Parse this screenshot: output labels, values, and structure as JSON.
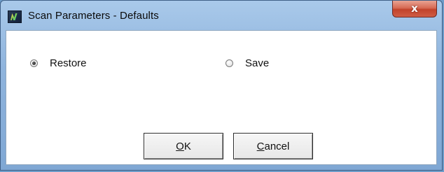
{
  "window": {
    "title": "Scan Parameters - Defaults",
    "close_glyph": "x"
  },
  "options": [
    {
      "label": "Restore",
      "selected": true
    },
    {
      "label": "Save",
      "selected": false
    }
  ],
  "buttons": {
    "ok": {
      "mnemonic": "O",
      "rest": "K"
    },
    "cancel": {
      "mnemonic": "C",
      "rest": "ancel"
    }
  },
  "colors": {
    "titlebar": "#8fb4dd",
    "close_button": "#c2432b"
  },
  "icons": {
    "app": "app-logo-icon",
    "close": "close-icon"
  }
}
